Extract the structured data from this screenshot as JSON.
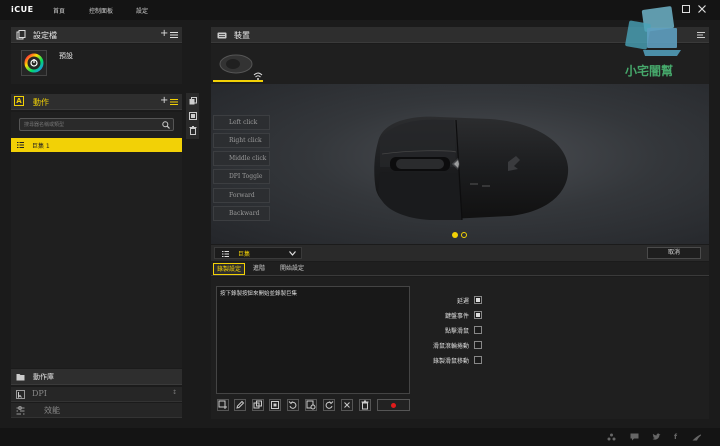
{
  "app": {
    "name": "iCUE"
  },
  "nav": {
    "tabs": [
      "首頁",
      "控制面板",
      "設定"
    ]
  },
  "profiles": {
    "title": "設定檔",
    "default_profile": "預設"
  },
  "actions": {
    "title": "動作",
    "search_placeholder": "搜尋器名稱或類型",
    "macro_item": "巨集 1"
  },
  "library": {
    "title": "動作庫",
    "items": [
      {
        "label": "DPI",
        "icon": "cursor-dpi-icon"
      },
      {
        "label": "效能",
        "icon": "performance-icon"
      }
    ]
  },
  "device": {
    "title": "裝置"
  },
  "watermark": {
    "text": "小宅闇幫"
  },
  "key_buttons": [
    "Left click",
    "Right click",
    "Middle click",
    "DPI Toggle",
    "Forward",
    "Backward"
  ],
  "carousel": {
    "dots": 2,
    "active": 0
  },
  "settings": {
    "action_type": "巨集",
    "cancel_label": "取消",
    "tabs": [
      "錄製設定",
      "進階",
      "開始設定"
    ],
    "active_tab": 0,
    "record_hint": "按下錄製按鈕來開始並錄製巨集",
    "options": [
      {
        "label": "延遲",
        "checked": true
      },
      {
        "label": "鍵盤事件",
        "checked": true
      },
      {
        "label": "點擊滑鼠",
        "checked": false
      },
      {
        "label": "滑鼠滾輪捲動",
        "checked": false
      },
      {
        "label": "錄製滑鼠移動",
        "checked": false
      }
    ]
  },
  "colors": {
    "accent": "#f2d106",
    "record": "#e01b1b",
    "background": "#1b1b1b"
  }
}
